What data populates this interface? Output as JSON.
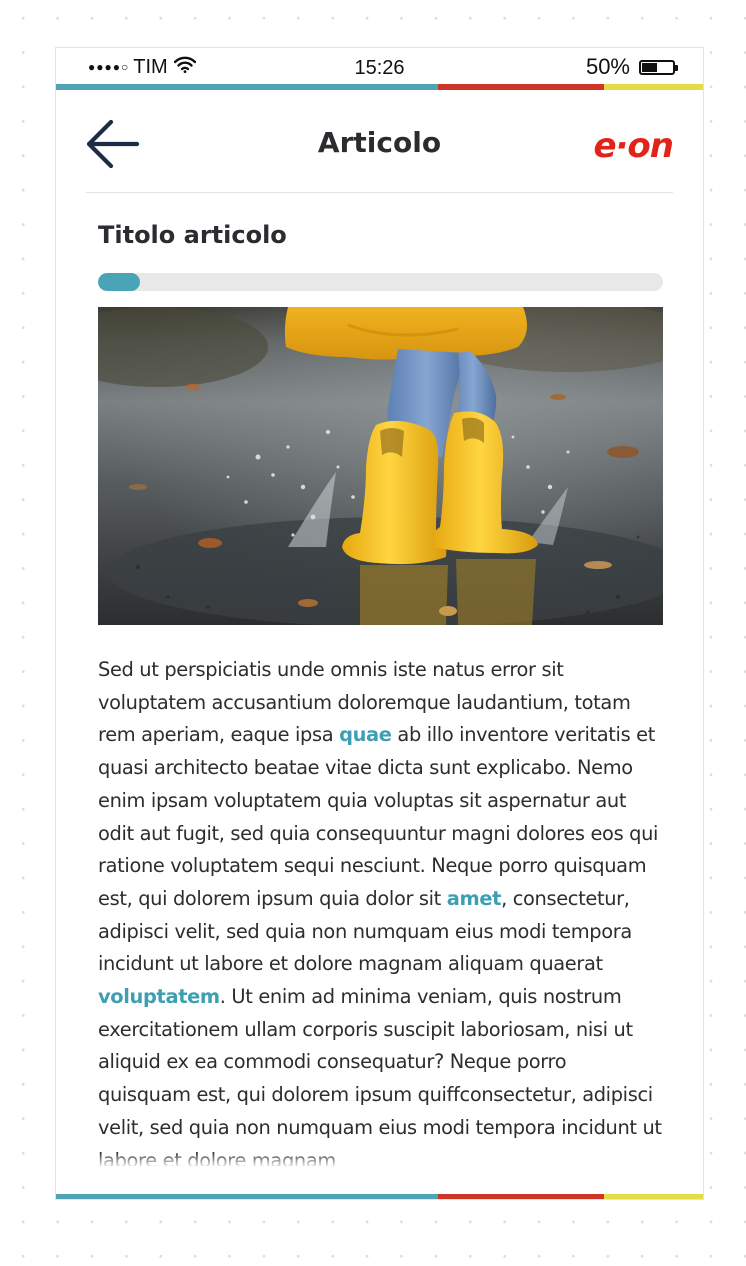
{
  "status_bar": {
    "carrier": "TIM",
    "time": "15:26",
    "battery_label": "50%",
    "battery_level": 0.5,
    "icons": [
      "signal-dots-icon",
      "wifi-icon",
      "battery-icon"
    ]
  },
  "header": {
    "title": "Articolo",
    "logo_text": "e·on",
    "back_icon": "arrow-left-icon"
  },
  "article": {
    "heading": "Titolo articolo",
    "reading_progress": 0.075,
    "image_subject": "child in yellow raincoat and yellow rain boots splashing in a puddle",
    "body_runs": [
      {
        "text": "Sed ut perspiciatis unde omnis iste natus error sit voluptatem accusantium doloremque laudantium, totam rem aperiam, eaque ipsa ",
        "link": false
      },
      {
        "text": "quae",
        "link": true
      },
      {
        "text": " ab illo inventore veritatis et quasi architecto beatae vitae dicta sunt explicabo. Nemo enim ipsam voluptatem quia voluptas sit aspernatur aut odit aut fugit, sed quia consequuntur magni dolores eos qui ratione voluptatem sequi nesciunt. Neque porro quisquam est, qui dolorem ipsum quia dolor sit ",
        "link": false
      },
      {
        "text": "amet",
        "link": true
      },
      {
        "text": ", consectetur, adipisci velit, sed quia non numquam eius modi tempora incidunt ut labore et dolore magnam aliquam quaerat ",
        "link": false
      },
      {
        "text": "voluptatem",
        "link": true
      },
      {
        "text": ". Ut enim ad minima veniam, quis nostrum exercitationem ullam corporis suscipit laboriosam, nisi ut aliquid ex ea commodi consequatur? Neque porro quisquam est, qui dolorem ipsum quiffconsectetur, adipisci velit, sed quia non numquam eius modi tempora incidunt ut labore et dolore magnam",
        "link": false
      }
    ]
  },
  "colors": {
    "brand_red": "#e2231a",
    "accent_teal": "#4aa4b6",
    "link_teal": "#3e9fb3",
    "strip_blue": "#4fa3b5",
    "strip_red": "#cf3526",
    "strip_yellow": "#e4dc45",
    "text_dark": "#2d2d31"
  }
}
